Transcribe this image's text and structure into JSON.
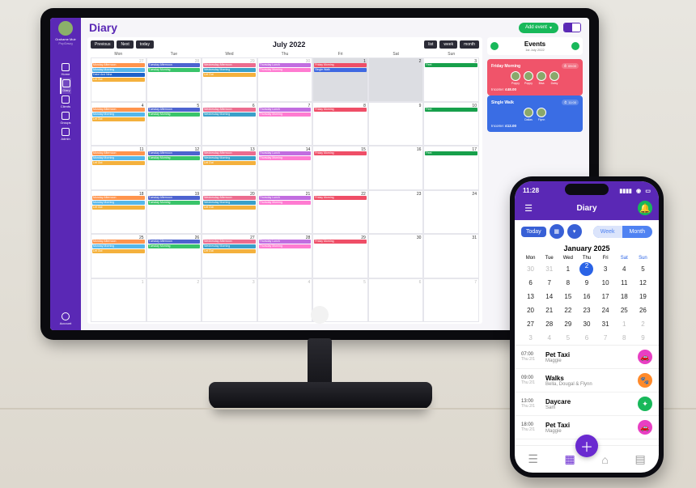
{
  "desktop": {
    "user": {
      "name": "Grahame Muir",
      "org": "PopDawg"
    },
    "page_title": "Diary",
    "add_label": "Add event",
    "sidebar": [
      {
        "icon": "home-icon",
        "label": "Home"
      },
      {
        "icon": "calendar-icon",
        "label": "Diary",
        "active": true
      },
      {
        "icon": "users-icon",
        "label": "Clients"
      },
      {
        "icon": "bone-icon",
        "label": "Groups"
      },
      {
        "icon": "gear-icon",
        "label": "Admin"
      }
    ],
    "sidebar_footer": {
      "icon": "user-icon",
      "label": "Account"
    },
    "calendar": {
      "nav": {
        "prev": "Previous",
        "next": "Next",
        "today": "today"
      },
      "title": "July 2022",
      "views": {
        "list": "list",
        "week": "week",
        "month": "month"
      },
      "dow": [
        "Mon",
        "Tue",
        "Wed",
        "Thu",
        "Fri",
        "Sat",
        "Sun"
      ],
      "weeks": [
        [
          {
            "n": 27,
            "muted": true,
            "ev": [
              [
                "c-ma",
                "Monday Afternoon"
              ],
              [
                "c-mm",
                "Monday Morning"
              ],
              [
                "c-daan",
                "Dalot And Nina"
              ],
              [
                "c-lo",
                "Let Out"
              ]
            ]
          },
          {
            "n": 28,
            "muted": true,
            "ev": [
              [
                "c-ta",
                "Tuesday Afternoon"
              ],
              [
                "c-tm",
                "Tuesday Morning"
              ]
            ]
          },
          {
            "n": 29,
            "muted": true,
            "ev": [
              [
                "c-wa",
                "Wednesday Afternoon"
              ],
              [
                "c-wm",
                "Wednesday Morning"
              ],
              [
                "c-lo",
                "Let Out"
              ]
            ]
          },
          {
            "n": 30,
            "muted": true,
            "ev": [
              [
                "c-tl",
                "Thursday Lunch"
              ],
              [
                "c-thm",
                "Thursday Morning"
              ]
            ]
          },
          {
            "n": 1,
            "grey": true,
            "ev": [
              [
                "c-fm",
                "Friday Morning"
              ],
              [
                "c-sw",
                "Single Walk"
              ]
            ]
          },
          {
            "n": 2,
            "grey": true,
            "ev": []
          },
          {
            "n": 3,
            "ev": [
              [
                "c-feet",
                "Feet"
              ]
            ]
          }
        ],
        [
          {
            "n": 4,
            "ev": [
              [
                "c-ma",
                "Monday Afternoon"
              ],
              [
                "c-mm",
                "Monday Morning"
              ],
              [
                "c-lo",
                "Let Out"
              ]
            ]
          },
          {
            "n": 5,
            "ev": [
              [
                "c-ta",
                "Tuesday Afternoon"
              ],
              [
                "c-tm",
                "Tuesday Morning"
              ]
            ]
          },
          {
            "n": 6,
            "ev": [
              [
                "c-wa",
                "Wednesday Afternoon"
              ],
              [
                "c-wm",
                "Wednesday Morning"
              ]
            ]
          },
          {
            "n": 7,
            "ev": [
              [
                "c-tl",
                "Thursday Lunch"
              ],
              [
                "c-thm",
                "Thursday Morning"
              ]
            ]
          },
          {
            "n": 8,
            "ev": [
              [
                "c-fm",
                "Friday Morning"
              ]
            ]
          },
          {
            "n": 9,
            "ev": []
          },
          {
            "n": 10,
            "ev": [
              [
                "c-feet",
                "Feet"
              ]
            ]
          }
        ],
        [
          {
            "n": 11,
            "ev": [
              [
                "c-ma",
                "Monday Afternoon"
              ],
              [
                "c-mm",
                "Monday Morning"
              ],
              [
                "c-lo",
                "Let Out"
              ]
            ]
          },
          {
            "n": 12,
            "ev": [
              [
                "c-ta",
                "Tuesday Afternoon"
              ],
              [
                "c-tm",
                "Tuesday Morning"
              ]
            ]
          },
          {
            "n": 13,
            "ev": [
              [
                "c-wa",
                "Wednesday Afternoon"
              ],
              [
                "c-wm",
                "Wednesday Morning"
              ],
              [
                "c-lo",
                "Let Out"
              ]
            ]
          },
          {
            "n": 14,
            "ev": [
              [
                "c-tl",
                "Thursday Lunch"
              ],
              [
                "c-thm",
                "Thursday Morning"
              ]
            ]
          },
          {
            "n": 15,
            "ev": [
              [
                "c-fm",
                "Friday Morning"
              ]
            ]
          },
          {
            "n": 16,
            "ev": []
          },
          {
            "n": 17,
            "ev": [
              [
                "c-feet",
                "Feet"
              ]
            ]
          }
        ],
        [
          {
            "n": 18,
            "ev": [
              [
                "c-ma",
                "Monday Afternoon"
              ],
              [
                "c-mm",
                "Monday Morning"
              ],
              [
                "c-lo",
                "Let Out"
              ]
            ]
          },
          {
            "n": 19,
            "ev": [
              [
                "c-ta",
                "Tuesday Afternoon"
              ],
              [
                "c-tm",
                "Tuesday Morning"
              ]
            ]
          },
          {
            "n": 20,
            "ev": [
              [
                "c-wa",
                "Wednesday Afternoon"
              ],
              [
                "c-wm",
                "Wednesday Morning"
              ],
              [
                "c-lo",
                "Let Out"
              ]
            ]
          },
          {
            "n": 21,
            "ev": [
              [
                "c-tl",
                "Thursday Lunch"
              ],
              [
                "c-thm",
                "Thursday Morning"
              ]
            ]
          },
          {
            "n": 22,
            "ev": [
              [
                "c-fm",
                "Friday Morning"
              ]
            ]
          },
          {
            "n": 23,
            "ev": []
          },
          {
            "n": 24,
            "ev": []
          }
        ],
        [
          {
            "n": 25,
            "ev": [
              [
                "c-ma",
                "Monday Afternoon"
              ],
              [
                "c-mm",
                "Monday Morning"
              ],
              [
                "c-lo",
                "Let Out"
              ]
            ]
          },
          {
            "n": 26,
            "ev": [
              [
                "c-ta",
                "Tuesday Afternoon"
              ],
              [
                "c-tm",
                "Tuesday Morning"
              ]
            ]
          },
          {
            "n": 27,
            "ev": [
              [
                "c-wa",
                "Wednesday Afternoon"
              ],
              [
                "c-wm",
                "Wednesday Morning"
              ],
              [
                "c-lo",
                "Let Out"
              ]
            ]
          },
          {
            "n": 28,
            "ev": [
              [
                "c-tl",
                "Thursday Lunch"
              ],
              [
                "c-thm",
                "Thursday Morning"
              ]
            ]
          },
          {
            "n": 29,
            "ev": [
              [
                "c-fm",
                "Friday Morning"
              ]
            ]
          },
          {
            "n": 30,
            "ev": []
          },
          {
            "n": 31,
            "ev": []
          }
        ],
        [
          {
            "n": 1,
            "muted": true,
            "ev": []
          },
          {
            "n": 2,
            "muted": true,
            "ev": []
          },
          {
            "n": 3,
            "muted": true,
            "ev": []
          },
          {
            "n": 4,
            "muted": true,
            "ev": []
          },
          {
            "n": 5,
            "muted": true,
            "ev": []
          },
          {
            "n": 6,
            "muted": true,
            "ev": []
          },
          {
            "n": 7,
            "muted": true,
            "ev": []
          }
        ]
      ]
    },
    "events": {
      "title": "Events",
      "date": "1st July 2022",
      "cards": [
        {
          "color": "red",
          "title": "Friday Morning",
          "time": "09:00",
          "pets": [
            "Poppy",
            "Poppy",
            "Bisa",
            "Daisy"
          ],
          "income_label": "Income:",
          "income": "£48.00"
        },
        {
          "color": "blue",
          "title": "Single Walk",
          "time": "11:00",
          "pets": [
            "Dallas",
            "Flynn"
          ],
          "income_label": "Income:",
          "income": "£12.00"
        }
      ]
    }
  },
  "phone": {
    "time": "11:28",
    "page_title": "Diary",
    "today_label": "Today",
    "seg": {
      "week": "Week",
      "month": "Month"
    },
    "month_title": "January 2025",
    "dow": [
      "Mon",
      "Tue",
      "Wed",
      "Thu",
      "Fri",
      "Sat",
      "Sun"
    ],
    "days": [
      [
        30,
        31,
        1,
        2,
        3,
        4,
        5
      ],
      [
        6,
        7,
        8,
        9,
        10,
        11,
        12
      ],
      [
        13,
        14,
        15,
        16,
        17,
        18,
        19
      ],
      [
        20,
        21,
        22,
        23,
        24,
        25,
        26
      ],
      [
        27,
        28,
        29,
        30,
        31,
        1,
        2
      ],
      [
        3,
        4,
        5,
        6,
        7,
        8,
        9
      ]
    ],
    "selected": 2,
    "mute_leading": 2,
    "mute_trailing": 9,
    "list": [
      {
        "time": "07:00",
        "sub": "Thu 2/1",
        "title": "Pet Taxi",
        "pets": "Maggie",
        "badge": "bg-pink",
        "icon": "🚗"
      },
      {
        "time": "09:00",
        "sub": "Thu 2/1",
        "title": "Walks",
        "pets": "Bella, Dougal & Flynn",
        "badge": "bg-orange",
        "icon": "🐾"
      },
      {
        "time": "13:00",
        "sub": "Thu 2/1",
        "title": "Daycare",
        "pets": "Sam",
        "badge": "bg-green",
        "icon": "✦"
      },
      {
        "time": "18:00",
        "sub": "Thu 2/1",
        "title": "Pet Taxi",
        "pets": "Maggie",
        "badge": "bg-pink",
        "icon": "🚗"
      }
    ]
  }
}
